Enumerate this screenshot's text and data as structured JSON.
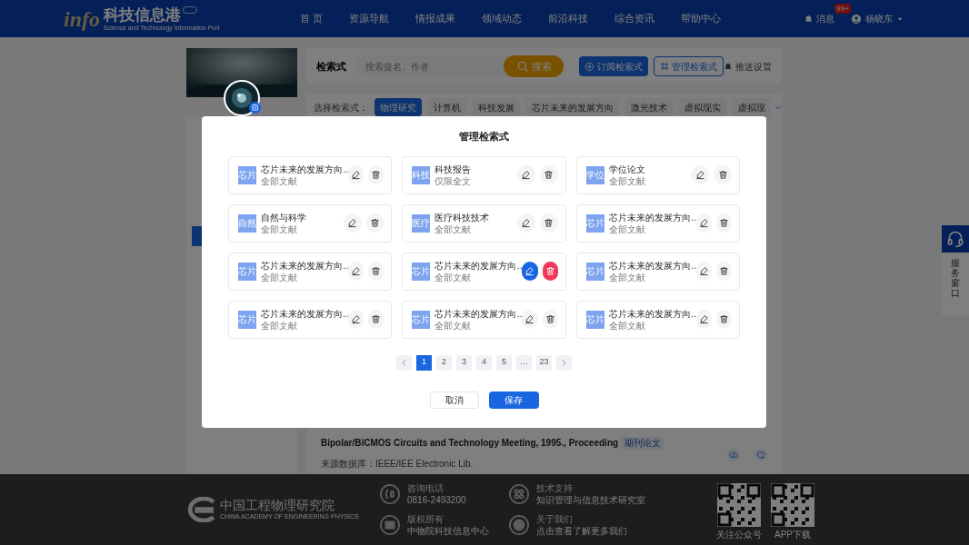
{
  "header": {
    "logo_mark": "info",
    "logo_title": "科技信息港",
    "logo_subtitle": "Science and Technology Information Port",
    "nav": [
      "首 页",
      "资源导航",
      "情报成果",
      "领域动态",
      "前沿科技",
      "综合资讯",
      "帮助中心"
    ],
    "messages": {
      "label": "消息",
      "badge": "99+"
    },
    "user": {
      "name": "杨晓东"
    }
  },
  "search_bar": {
    "title": "检索式",
    "placeholder": "搜索提名、作者",
    "search_button": "搜索",
    "subscribe_button": "订阅检索式",
    "manage_button": "管理检索式",
    "push_settings": "推送设置"
  },
  "filter": {
    "label": "选择检索式：",
    "tags": [
      {
        "label": "物理研究",
        "selected": true
      },
      {
        "label": "计算机",
        "selected": false
      },
      {
        "label": "科技发展",
        "selected": false
      },
      {
        "label": "芯片未来的发展方向",
        "selected": false
      },
      {
        "label": "激光技术",
        "selected": false
      },
      {
        "label": "虚拟现实",
        "selected": false
      },
      {
        "label": "虚拟现",
        "selected": false
      }
    ]
  },
  "result": {
    "title": "Bipolar/BiCMOS Circuits and Technology Meeting, 1995., Proceeding",
    "tag": "期刊论文",
    "source": "来源数据库：IEEE/IEE Electronic Lib."
  },
  "service": {
    "label": "服务窗口"
  },
  "footer": {
    "org_name": "中国工程物理研究院",
    "org_name_en": "CHINA ACADEMY OF ENGINEERING PHYSICS",
    "contacts": [
      {
        "kind": "phone",
        "label": "咨询电话",
        "value": "0816-2493200"
      },
      {
        "kind": "copyright",
        "label": "版权所有",
        "value": "中物院科技信息中心"
      },
      {
        "kind": "support",
        "label": "技术支持",
        "value": "知识管理与信息技术研究室"
      },
      {
        "kind": "about",
        "label": "关于我们",
        "value": "点击查看了解更多我们"
      }
    ],
    "qr_codes": [
      "关注公众号",
      "APP下载"
    ]
  },
  "modal": {
    "title": "管理检索式",
    "items": [
      {
        "badge": "芯片",
        "name": "芯片未来的发展方向…",
        "scope": "全部文献",
        "hovered": false
      },
      {
        "badge": "科技",
        "name": "科技报告",
        "scope": "仅限全文",
        "hovered": false
      },
      {
        "badge": "学位",
        "name": "学位论文",
        "scope": "全部文献",
        "hovered": false
      },
      {
        "badge": "自然",
        "name": "自然与科学",
        "scope": "全部文献",
        "hovered": false
      },
      {
        "badge": "医疗",
        "name": "医疗科技技术",
        "scope": "全部文献",
        "hovered": false
      },
      {
        "badge": "芯片",
        "name": "芯片未来的发展方向…",
        "scope": "全部文献",
        "hovered": false
      },
      {
        "badge": "芯片",
        "name": "芯片未来的发展方向…",
        "scope": "全部文献",
        "hovered": false
      },
      {
        "badge": "芯片",
        "name": "芯片未来的发展方向…",
        "scope": "全部文献",
        "hovered": true
      },
      {
        "badge": "芯片",
        "name": "芯片未来的发展方向…",
        "scope": "全部文献",
        "hovered": false
      },
      {
        "badge": "芯片",
        "name": "芯片未来的发展方向…",
        "scope": "全部文献",
        "hovered": false
      },
      {
        "badge": "芯片",
        "name": "芯片未来的发展方向…",
        "scope": "全部文献",
        "hovered": false
      },
      {
        "badge": "芯片",
        "name": "芯片未来的发展方向…",
        "scope": "全部文献",
        "hovered": false
      }
    ],
    "pages": [
      {
        "label": "1",
        "selected": true
      },
      {
        "label": "2",
        "selected": false
      },
      {
        "label": "3",
        "selected": false
      },
      {
        "label": "4",
        "selected": false
      },
      {
        "label": "5",
        "selected": false
      },
      {
        "label": "…",
        "selected": false
      },
      {
        "label": "23",
        "selected": false
      }
    ],
    "cancel_button": "取消",
    "save_button": "保存"
  }
}
